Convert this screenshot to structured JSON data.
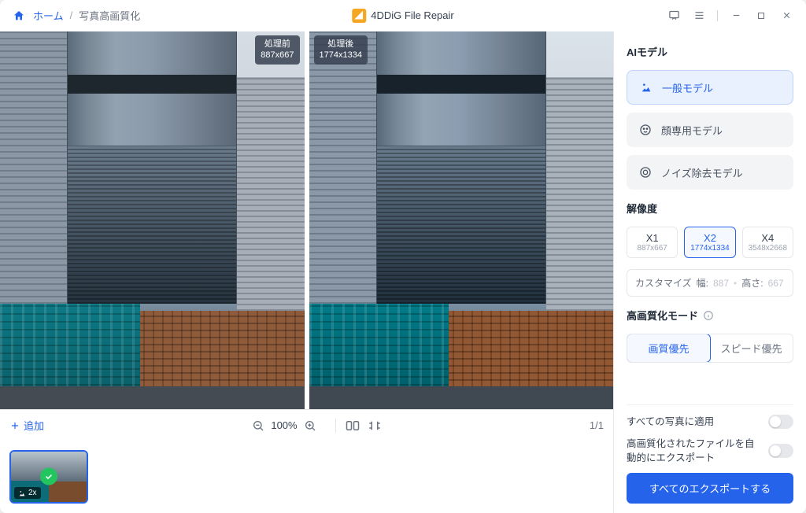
{
  "titlebar": {
    "home": "ホーム",
    "sep": "/",
    "current": "写真高画質化",
    "app_name": "4DDiG File Repair"
  },
  "image_compare": {
    "before_label": "処理前",
    "before_dim": "887x667",
    "after_label": "処理後",
    "after_dim": "1774x1334"
  },
  "toolbar": {
    "add_label": "追加",
    "zoom_value": "100%",
    "page_indicator": "1/1"
  },
  "thumbnail": {
    "scale_badge": "2x"
  },
  "panel": {
    "ai_model_title": "AIモデル",
    "models": {
      "general": "一般モデル",
      "face": "顔専用モデル",
      "denoise": "ノイズ除去モデル"
    },
    "resolution_title": "解像度",
    "res": {
      "x1_label": "X1",
      "x1_dim": "887x667",
      "x2_label": "X2",
      "x2_dim": "1774x1334",
      "x4_label": "X4",
      "x4_dim": "3548x2668"
    },
    "customize_label": "カスタマイズ",
    "width_label": "幅:",
    "width_value": "887",
    "height_label": "高さ:",
    "height_value": "667",
    "mode_title": "高画質化モード",
    "mode_quality": "画質優先",
    "mode_speed": "スピード優先",
    "apply_all": "すべての写真に適用",
    "auto_export": "高画質化されたファイルを自動的にエクスポート",
    "export_all": "すべてのエクスポートする"
  }
}
